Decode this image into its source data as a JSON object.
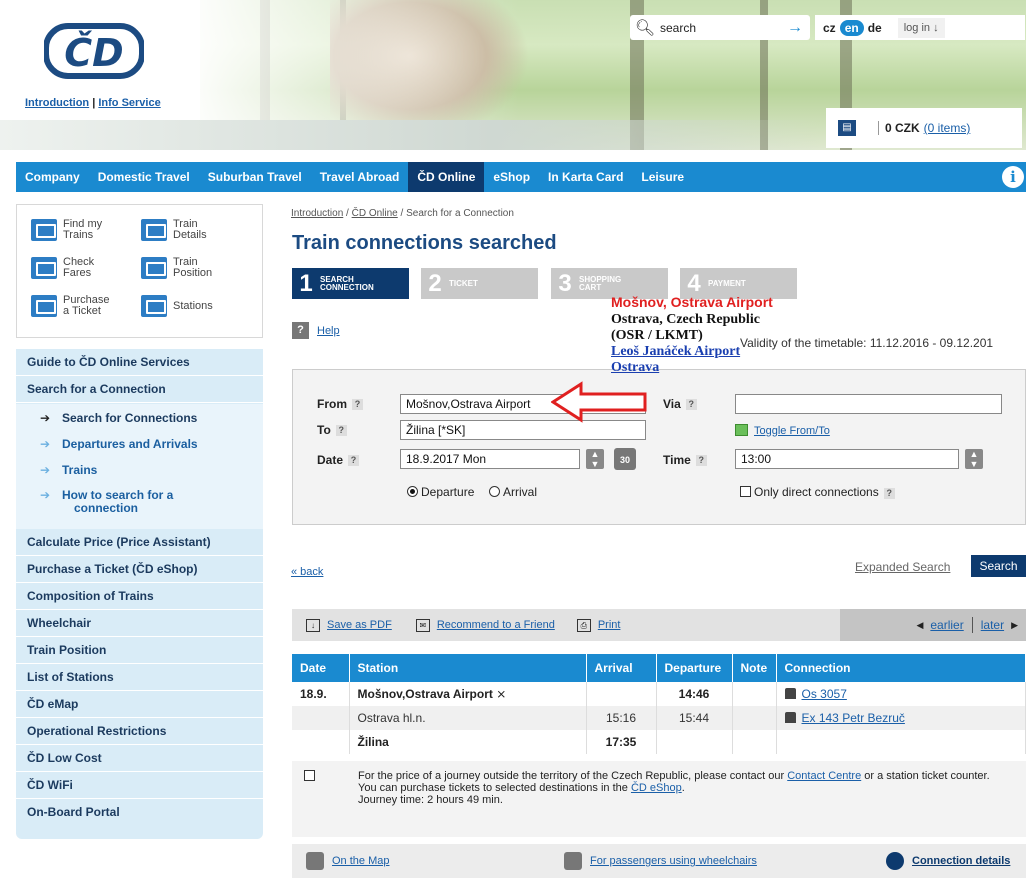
{
  "header": {
    "links": [
      "Introduction",
      "Info Service"
    ],
    "search_placeholder": "search",
    "languages": [
      "cz",
      "en",
      "de"
    ],
    "login": "log in",
    "cart_amount": "0 CZK",
    "cart_items": "(0 items)"
  },
  "nav": {
    "items": [
      "Company",
      "Domestic Travel",
      "Suburban Travel",
      "Travel Abroad",
      "ČD Online",
      "eShop",
      "In Karta Card",
      "Leisure"
    ],
    "active": "ČD Online"
  },
  "quick_links": [
    {
      "line1": "Find my",
      "line2": "Trains"
    },
    {
      "line1": "Train",
      "line2": "Details"
    },
    {
      "line1": "Check",
      "line2": "Fares"
    },
    {
      "line1": "Train",
      "line2": "Position"
    },
    {
      "line1": "Purchase",
      "line2": "a Ticket"
    },
    {
      "line1": "Stations",
      "line2": ""
    }
  ],
  "menu": {
    "top": [
      "Guide to ČD Online Services",
      "Search for a Connection"
    ],
    "sub": [
      "Search for Connections",
      "Departures and Arrivals",
      "Trains",
      "How to search for a",
      "connection"
    ],
    "bottom": [
      "Calculate Price (Price Assistant)",
      "Purchase a Ticket (ČD eShop)",
      "Composition of Trains",
      "Wheelchair",
      "Train Position",
      "List of Stations",
      "ČD eMap",
      "Operational Restrictions",
      "ČD Low Cost",
      "ČD WiFi",
      "On-Board Portal"
    ]
  },
  "breadcrumb": {
    "a": "Introduction",
    "sep": " / ",
    "b": "ČD Online",
    "c": " / Search for a Connection"
  },
  "title": "Train connections searched",
  "steps": [
    {
      "num": "1",
      "l1": "Search",
      "l2": "Connection"
    },
    {
      "num": "2",
      "l1": "Ticket",
      "l2": ""
    },
    {
      "num": "3",
      "l1": "Shopping",
      "l2": "Cart"
    },
    {
      "num": "4",
      "l1": "Payment",
      "l2": ""
    }
  ],
  "help": "Help",
  "validity": "Validity of the timetable: 11.12.2016 - 09.12.201",
  "annotation": {
    "red": "Mošnov, Ostrava Airport",
    "black": "Ostrava, Czech Republic (OSR / LKMT)",
    "link": "Leoš Janáček Airport Ostrava"
  },
  "form": {
    "from_label": "From",
    "from_value": "Mošnov,Ostrava Airport",
    "to_label": "To",
    "to_value": "Žilina [*SK]",
    "via_label": "Via",
    "via_value": "",
    "toggle": "Toggle From/To",
    "date_label": "Date",
    "date_value": "18.9.2017 Mon",
    "cal_text": "30",
    "time_label": "Time",
    "time_value": "13:00",
    "departure": "Departure",
    "arrival": "Arrival",
    "direct": "Only direct connections"
  },
  "actions": {
    "back": "« back",
    "expanded": "Expanded Search",
    "search": "Search"
  },
  "toolbar": {
    "pdf": "Save as PDF",
    "recommend": "Recommend to a Friend",
    "print": "Print",
    "earlier": "earlier",
    "later": "later"
  },
  "table": {
    "headers": [
      "Date",
      "Station",
      "Arrival",
      "Departure",
      "Note",
      "Connection"
    ],
    "rows": [
      {
        "date": "18.9.",
        "station": "Mošnov,Ostrava Airport",
        "arrival": "",
        "departure": "14:46",
        "note": "",
        "connection": "Os 3057"
      },
      {
        "date": "",
        "station": "Ostrava hl.n.",
        "arrival": "15:16",
        "departure": "15:44",
        "note": "",
        "connection": "Ex 143 Petr Bezruč"
      },
      {
        "date": "",
        "station": "Žilina",
        "arrival": "17:35",
        "departure": "",
        "note": "",
        "connection": ""
      }
    ],
    "note_before": "For the price of a journey outside the territory of the Czech Republic, please contact our",
    "note_link": "Contact Centre",
    "note_after": "or a station ticket counter.",
    "note2_before": "You can purchase tickets to selected destinations in the",
    "note2_link": "ČD eShop",
    "note3": "Journey time: 2 hours 49 min."
  },
  "bottom": {
    "map": "On the Map",
    "wheelchair": "For passengers using wheelchairs",
    "details": "Connection details"
  }
}
